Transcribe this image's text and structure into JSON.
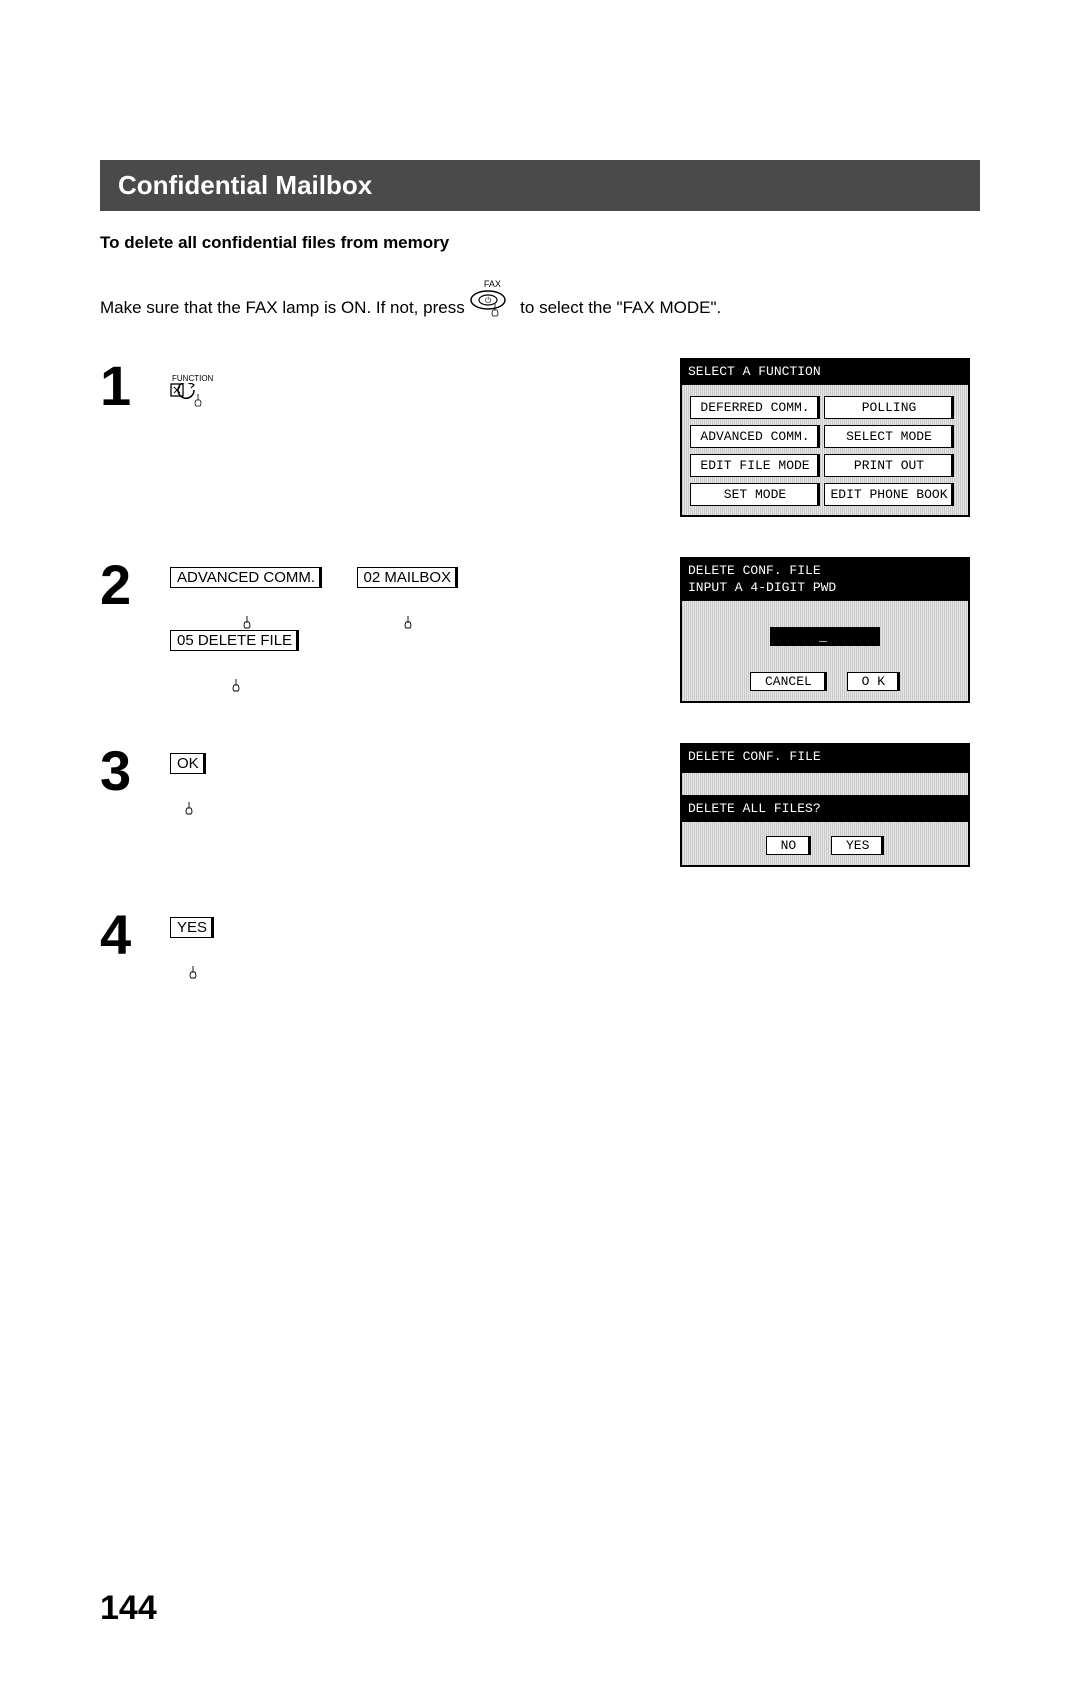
{
  "title": "Confidential Mailbox",
  "subheading": "To delete all confidential files from memory",
  "intro_a": "Make sure that the FAX lamp is ON.  If not, press",
  "intro_b": "to select the \"FAX MODE\".",
  "faxlabel": "FAX",
  "step1": {
    "num": "1",
    "funclabel": "FUNCTION"
  },
  "step2": {
    "num": "2",
    "btn1": "ADVANCED COMM.",
    "btn2": "02 MAILBOX",
    "btn3": "05 DELETE FILE"
  },
  "step3": {
    "num": "3",
    "btn": "OK"
  },
  "step4": {
    "num": "4",
    "btn": "YES"
  },
  "screen1": {
    "title": "SELECT A FUNCTION",
    "b1": "DEFERRED COMM.",
    "b2": "POLLING",
    "b3": "ADVANCED COMM.",
    "b4": "SELECT MODE",
    "b5": "EDIT FILE MODE",
    "b6": "PRINT OUT",
    "b7": "SET MODE",
    "b8": "EDIT PHONE BOOK"
  },
  "screen2": {
    "line1": "DELETE CONF. FILE",
    "line2": "INPUT A 4-DIGIT PWD",
    "pwd": "_",
    "cancel": "CANCEL",
    "ok": "O K"
  },
  "screen3": {
    "title": "DELETE CONF. FILE",
    "question": "DELETE ALL FILES?",
    "no": "NO",
    "yes": "YES"
  },
  "pagenum": "144"
}
